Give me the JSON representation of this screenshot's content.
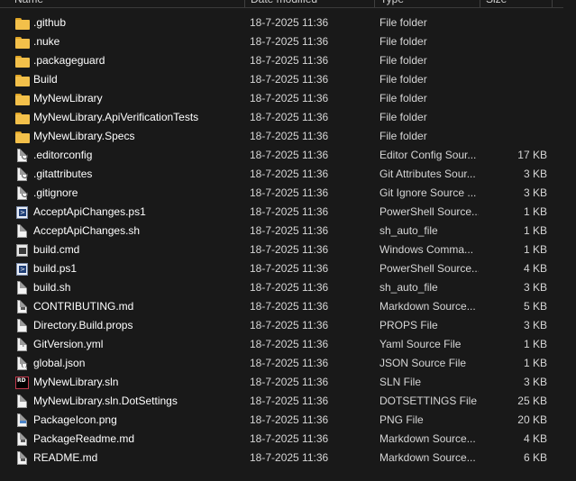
{
  "columns": {
    "name": "Name",
    "date": "Date modified",
    "type": "Type",
    "size": "Size"
  },
  "files": [
    {
      "name": ".github",
      "date": "18-7-2025 11:36",
      "type": "File folder",
      "size": "",
      "icon": "folder-icon"
    },
    {
      "name": ".nuke",
      "date": "18-7-2025 11:36",
      "type": "File folder",
      "size": "",
      "icon": "folder-icon"
    },
    {
      "name": ".packageguard",
      "date": "18-7-2025 11:36",
      "type": "File folder",
      "size": "",
      "icon": "folder-icon"
    },
    {
      "name": "Build",
      "date": "18-7-2025 11:36",
      "type": "File folder",
      "size": "",
      "icon": "folder-icon"
    },
    {
      "name": "MyNewLibrary",
      "date": "18-7-2025 11:36",
      "type": "File folder",
      "size": "",
      "icon": "folder-icon"
    },
    {
      "name": "MyNewLibrary.ApiVerificationTests",
      "date": "18-7-2025 11:36",
      "type": "File folder",
      "size": "",
      "icon": "folder-icon"
    },
    {
      "name": "MyNewLibrary.Specs",
      "date": "18-7-2025 11:36",
      "type": "File folder",
      "size": "",
      "icon": "folder-icon"
    },
    {
      "name": ".editorconfig",
      "date": "18-7-2025 11:36",
      "type": "Editor Config Sour...",
      "size": "17 KB",
      "icon": "config-file-icon"
    },
    {
      "name": ".gitattributes",
      "date": "18-7-2025 11:36",
      "type": "Git Attributes Sour...",
      "size": "3 KB",
      "icon": "config-file-icon"
    },
    {
      "name": ".gitignore",
      "date": "18-7-2025 11:36",
      "type": "Git Ignore Source ...",
      "size": "3 KB",
      "icon": "config-file-icon"
    },
    {
      "name": "AcceptApiChanges.ps1",
      "date": "18-7-2025 11:36",
      "type": "PowerShell Source...",
      "size": "1 KB",
      "icon": "powershell-file-icon"
    },
    {
      "name": "AcceptApiChanges.sh",
      "date": "18-7-2025 11:36",
      "type": "sh_auto_file",
      "size": "1 KB",
      "icon": "blank-file-icon"
    },
    {
      "name": "build.cmd",
      "date": "18-7-2025 11:36",
      "type": "Windows Comma...",
      "size": "1 KB",
      "icon": "cmd-file-icon"
    },
    {
      "name": "build.ps1",
      "date": "18-7-2025 11:36",
      "type": "PowerShell Source...",
      "size": "4 KB",
      "icon": "powershell-file-icon"
    },
    {
      "name": "build.sh",
      "date": "18-7-2025 11:36",
      "type": "sh_auto_file",
      "size": "3 KB",
      "icon": "blank-file-icon"
    },
    {
      "name": "CONTRIBUTING.md",
      "date": "18-7-2025 11:36",
      "type": "Markdown Source...",
      "size": "5 KB",
      "icon": "markdown-file-icon"
    },
    {
      "name": "Directory.Build.props",
      "date": "18-7-2025 11:36",
      "type": "PROPS File",
      "size": "3 KB",
      "icon": "blank-file-icon"
    },
    {
      "name": "GitVersion.yml",
      "date": "18-7-2025 11:36",
      "type": "Yaml Source File",
      "size": "1 KB",
      "icon": "yaml-file-icon"
    },
    {
      "name": "global.json",
      "date": "18-7-2025 11:36",
      "type": "JSON Source File",
      "size": "1 KB",
      "icon": "json-file-icon"
    },
    {
      "name": "MyNewLibrary.sln",
      "date": "18-7-2025 11:36",
      "type": "SLN File",
      "size": "3 KB",
      "icon": "rider-solution-icon"
    },
    {
      "name": "MyNewLibrary.sln.DotSettings",
      "date": "18-7-2025 11:36",
      "type": "DOTSETTINGS File",
      "size": "25 KB",
      "icon": "blank-file-icon"
    },
    {
      "name": "PackageIcon.png",
      "date": "18-7-2025 11:36",
      "type": "PNG File",
      "size": "20 KB",
      "icon": "image-file-icon"
    },
    {
      "name": "PackageReadme.md",
      "date": "18-7-2025 11:36",
      "type": "Markdown Source...",
      "size": "4 KB",
      "icon": "markdown-file-icon"
    },
    {
      "name": "README.md",
      "date": "18-7-2025 11:36",
      "type": "Markdown Source...",
      "size": "6 KB",
      "icon": "markdown-file-icon"
    }
  ],
  "rd_label": "RD"
}
